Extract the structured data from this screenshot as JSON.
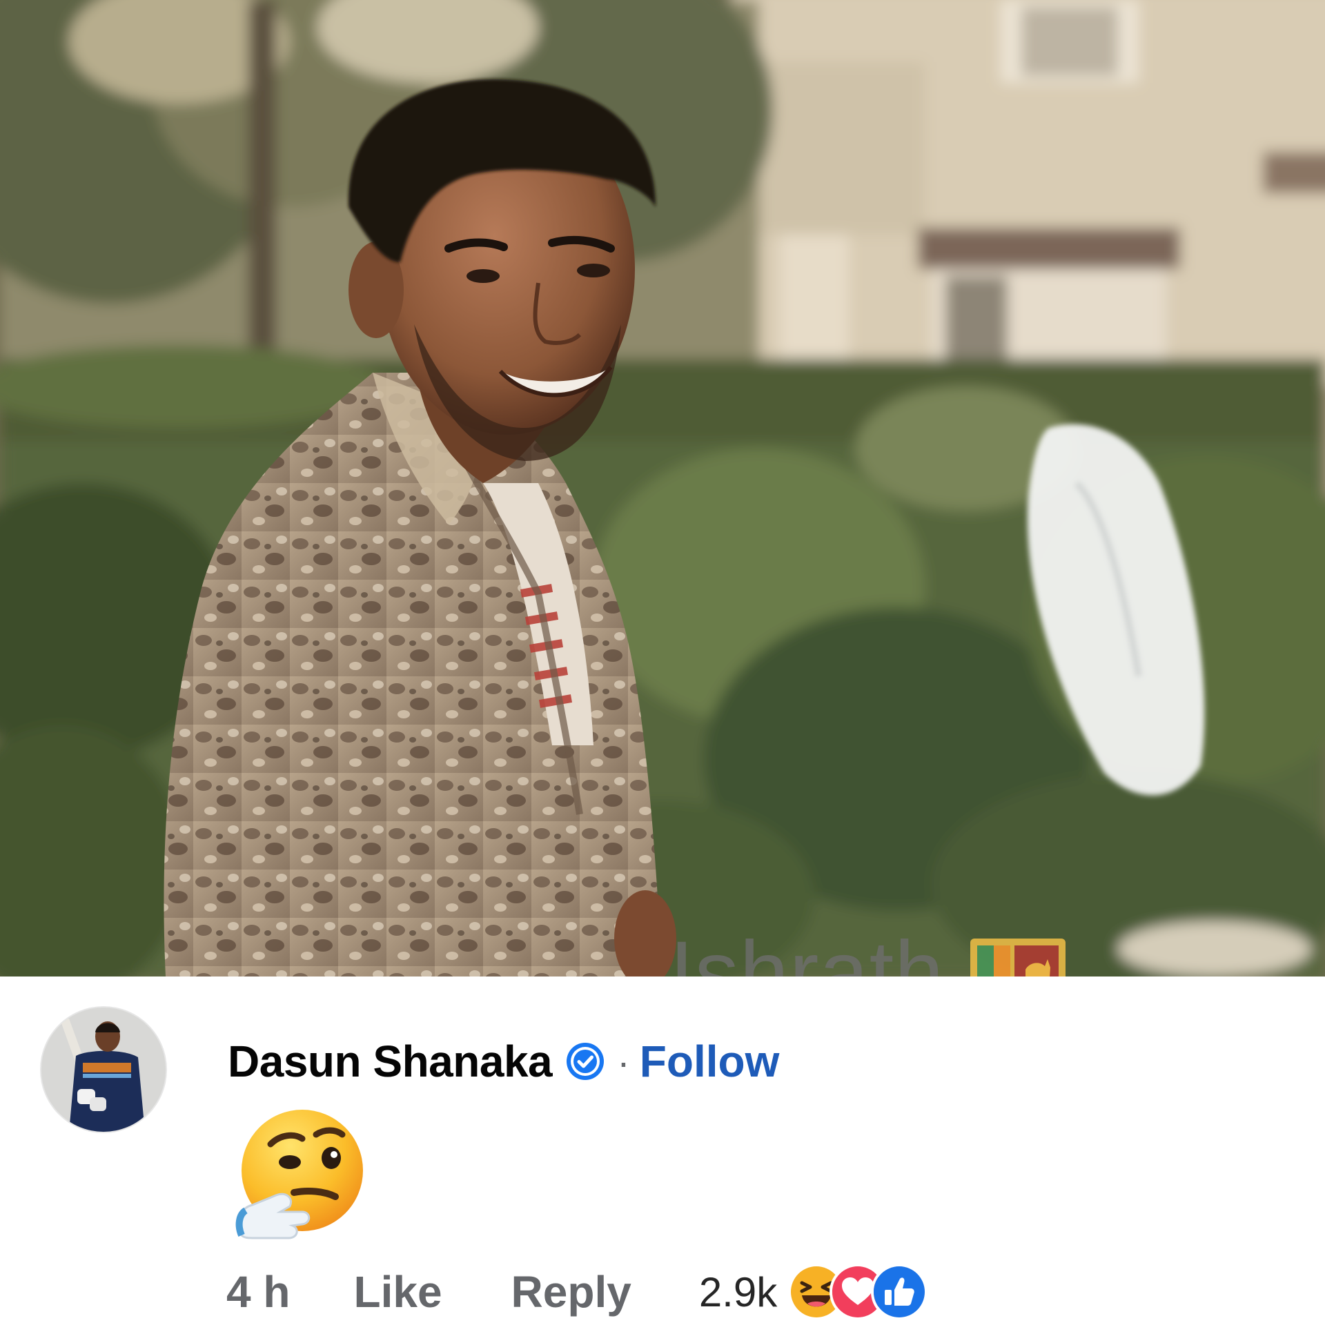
{
  "post": {
    "watermark": "Ishrath",
    "watermark_flag_icon": "sri-lanka-flag-icon"
  },
  "comment": {
    "author": "Dasun Shanaka",
    "verified_icon": "verified-badge-icon",
    "separator": "·",
    "follow_label": "Follow",
    "body_emoji": "thinking-face-emoji",
    "time": "4 h",
    "like_label": "Like",
    "reply_label": "Reply",
    "reaction_count": "2.9k",
    "reactions": [
      "haha-reaction-icon",
      "love-reaction-icon",
      "like-reaction-icon"
    ]
  },
  "colors": {
    "follow": "#1e5bb8",
    "verified": "#1877f2",
    "secondary_text": "#65676b"
  }
}
